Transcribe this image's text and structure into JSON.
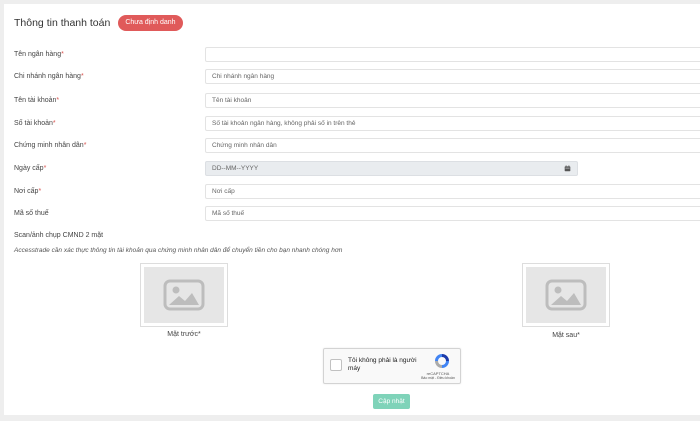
{
  "header": {
    "title": "Thông tin thanh toán",
    "status_badge": "Chưa định danh"
  },
  "form": {
    "fields": [
      {
        "label": "Tên ngân hàng",
        "placeholder": ""
      },
      {
        "label": "Chi nhánh ngân hàng",
        "placeholder": "Chi nhánh ngân hàng"
      },
      {
        "label": "Tên tài khoản",
        "placeholder": "Tên tài khoản"
      },
      {
        "label": "Số tài khoản",
        "placeholder": "Số tài khoản ngân hàng, không phải số in trên thẻ"
      },
      {
        "label": "Chứng minh nhân dân",
        "placeholder": "Chứng minh nhân dân"
      },
      {
        "label": "Ngày cấp",
        "placeholder": "DD--MM--YYYY"
      },
      {
        "label": "Nơi cấp",
        "placeholder": "Nơi cấp"
      },
      {
        "label": "Mã số thuế",
        "placeholder": "Mã số thuế"
      }
    ],
    "required_mark": "*"
  },
  "scan": {
    "label": "Scan/ảnh chụp CMND 2 mặt",
    "note": "Accesstrade cần xác thực thông tin tài khoản qua chứng minh nhân dân để chuyển tiền cho bạn nhanh chóng hơn",
    "front_caption": "Mặt trước*",
    "back_caption": "Mặt sau*"
  },
  "captcha": {
    "text": "Tôi không phải là người máy",
    "brand": "reCAPTCHA",
    "links": "Bảo mật - Điều khoản"
  },
  "actions": {
    "update_label": "Cập nhật"
  },
  "colors": {
    "badge": "#e05a5a",
    "required": "#d9534f",
    "button": "#7fd3b9"
  }
}
